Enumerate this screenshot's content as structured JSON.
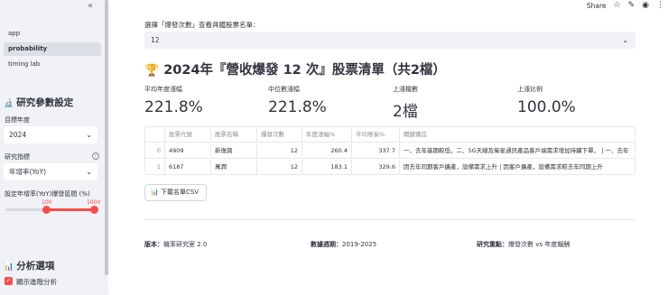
{
  "sidebar": {
    "collapse_icon": "«",
    "nav": [
      "app",
      "probability",
      "timing lab"
    ],
    "active_nav": 1,
    "settings_title": "研究參數設定",
    "settings_icon": "🔬",
    "year_label": "目標年度",
    "year_value": "2024",
    "metric_label": "研究指標",
    "metric_value": "年增率(YoY)",
    "range_label": "設定年增率(YoY)爆發區間 (%)",
    "range_min": "100",
    "range_max": "1000",
    "range_fill_fraction": [
      0.445,
      0.97
    ],
    "analysis_title": "分析選項",
    "analysis_icon": "📊",
    "checkbox_label": "顯示進階分析",
    "checkbox_checked": true
  },
  "toolbar": {
    "share": "Share",
    "icons": [
      "star-icon",
      "edit-icon",
      "github-icon",
      "menu-icon"
    ]
  },
  "main": {
    "select_label": "選擇「爆發次數」查看具體股票名單：",
    "select_value": "12",
    "title": "2024年『營收爆發 12 次』股票清單（共2檔）",
    "metrics": [
      {
        "label": "平均年度漲幅",
        "value": "221.8%"
      },
      {
        "label": "中位數漲幅",
        "value": "221.8%"
      },
      {
        "label": "上漲檔數",
        "value": "2檔"
      },
      {
        "label": "上漲比例",
        "value": "100.0%"
      }
    ],
    "table": {
      "headers": [
        "",
        "股票代號",
        "股票名稱",
        "爆發次數",
        "年度漲幅%",
        "平均增長%",
        "關鍵備註"
      ],
      "rows": [
        [
          "0",
          "4909",
          "新復興",
          "12",
          "260.4",
          "337.7",
          "一、去年基期較低，二、5G天線及衛星通訊產品客戶端需求增加持續下單， | 一、去年"
        ],
        [
          "1",
          "6187",
          "萬潤",
          "12",
          "183.1",
          "329.6",
          "因去年同期客戶擴產，設備需求上升 | 因客戶擴產，設備需求較去年同期上升"
        ]
      ]
    },
    "download_label": "下載名單CSV",
    "download_icon": "📊"
  },
  "footer": {
    "version_label": "版本：",
    "version_value": "機率研究室 2.0",
    "period_label": "數據週期：",
    "period_value": "2019-2025",
    "focus_label": "研究重點：",
    "focus_value": "爆發次數 vs 年度報酬"
  }
}
